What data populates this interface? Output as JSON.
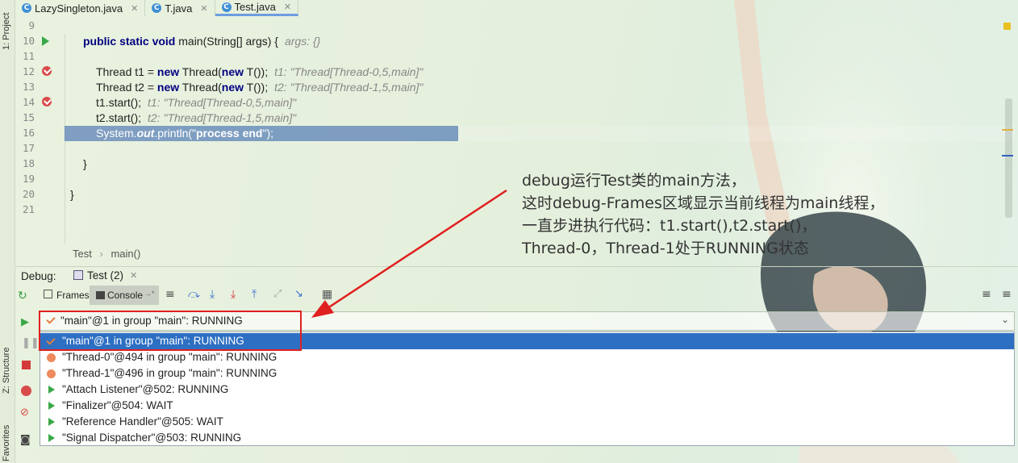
{
  "strip": {
    "project": "1: Project",
    "structure": "Z: Structure",
    "favorites": "Favorites"
  },
  "tabs": [
    {
      "label": "LazySingleton.java",
      "icon": "c-class-icon"
    },
    {
      "label": "T.java",
      "icon": "c-class-icon"
    },
    {
      "label": "Test.java",
      "icon": "c-class-icon",
      "active": true
    }
  ],
  "editor": {
    "line_numbers": [
      "9",
      "10",
      "11",
      "12",
      "13",
      "14",
      "15",
      "16",
      "17",
      "18",
      "19",
      "20",
      "21"
    ],
    "l10": {
      "kw": "public static void",
      "rest": " main(String[] args) {",
      "hint": "args: {}"
    },
    "l12": {
      "a": "Thread t1 = ",
      "kw1": "new",
      "b": " Thread(",
      "kw2": "new",
      "c": " T());",
      "hint": "t1: \"Thread[Thread-0,5,main]\""
    },
    "l13": {
      "a": "Thread t2 = ",
      "kw1": "new",
      "b": " Thread(",
      "kw2": "new",
      "c": " T());",
      "hint": "t2: \"Thread[Thread-1,5,main]\""
    },
    "l14": {
      "code": "t1.start();",
      "hint": "t1: \"Thread[Thread-0,5,main]\""
    },
    "l15": {
      "code": "t2.start();",
      "hint": "t2: \"Thread[Thread-1,5,main]\""
    },
    "l16": {
      "a": "System.",
      "b": "out",
      "c": ".println(\"",
      "d": "process end",
      "e": "\");"
    },
    "l18": "}",
    "l20": "}"
  },
  "breadcrumb": {
    "cls": "Test",
    "sep": "›",
    "method": "main()"
  },
  "debug": {
    "label": "Debug:",
    "session": "Test (2)",
    "frames_tab": "Frames",
    "console_tab": "Console",
    "console_suffix": "→*"
  },
  "thread_combo": "\"main\"@1 in group \"main\": RUNNING",
  "threads": [
    {
      "text": "\"main\"@1 in group \"main\": RUNNING",
      "state": "current"
    },
    {
      "text": "\"Thread-0\"@494 in group \"main\": RUNNING",
      "state": "dot"
    },
    {
      "text": "\"Thread-1\"@496 in group \"main\": RUNNING",
      "state": "dot"
    },
    {
      "text": "\"Attach Listener\"@502: RUNNING",
      "state": "play"
    },
    {
      "text": "\"Finalizer\"@504: WAIT",
      "state": "play"
    },
    {
      "text": "\"Reference Handler\"@505: WAIT",
      "state": "play"
    },
    {
      "text": "\"Signal Dispatcher\"@503: RUNNING",
      "state": "play"
    }
  ],
  "annotation": [
    "debug运行Test类的main方法，",
    "这时debug-Frames区域显示当前线程为main线程，",
    "一直步进执行代码：t1.start(),t2.start()，",
    "Thread-0，Thread-1处于RUNNING状态"
  ],
  "colors": {
    "selection": "#2d6fc2",
    "annotation_red": "#e02020",
    "keyword": "#000080"
  }
}
